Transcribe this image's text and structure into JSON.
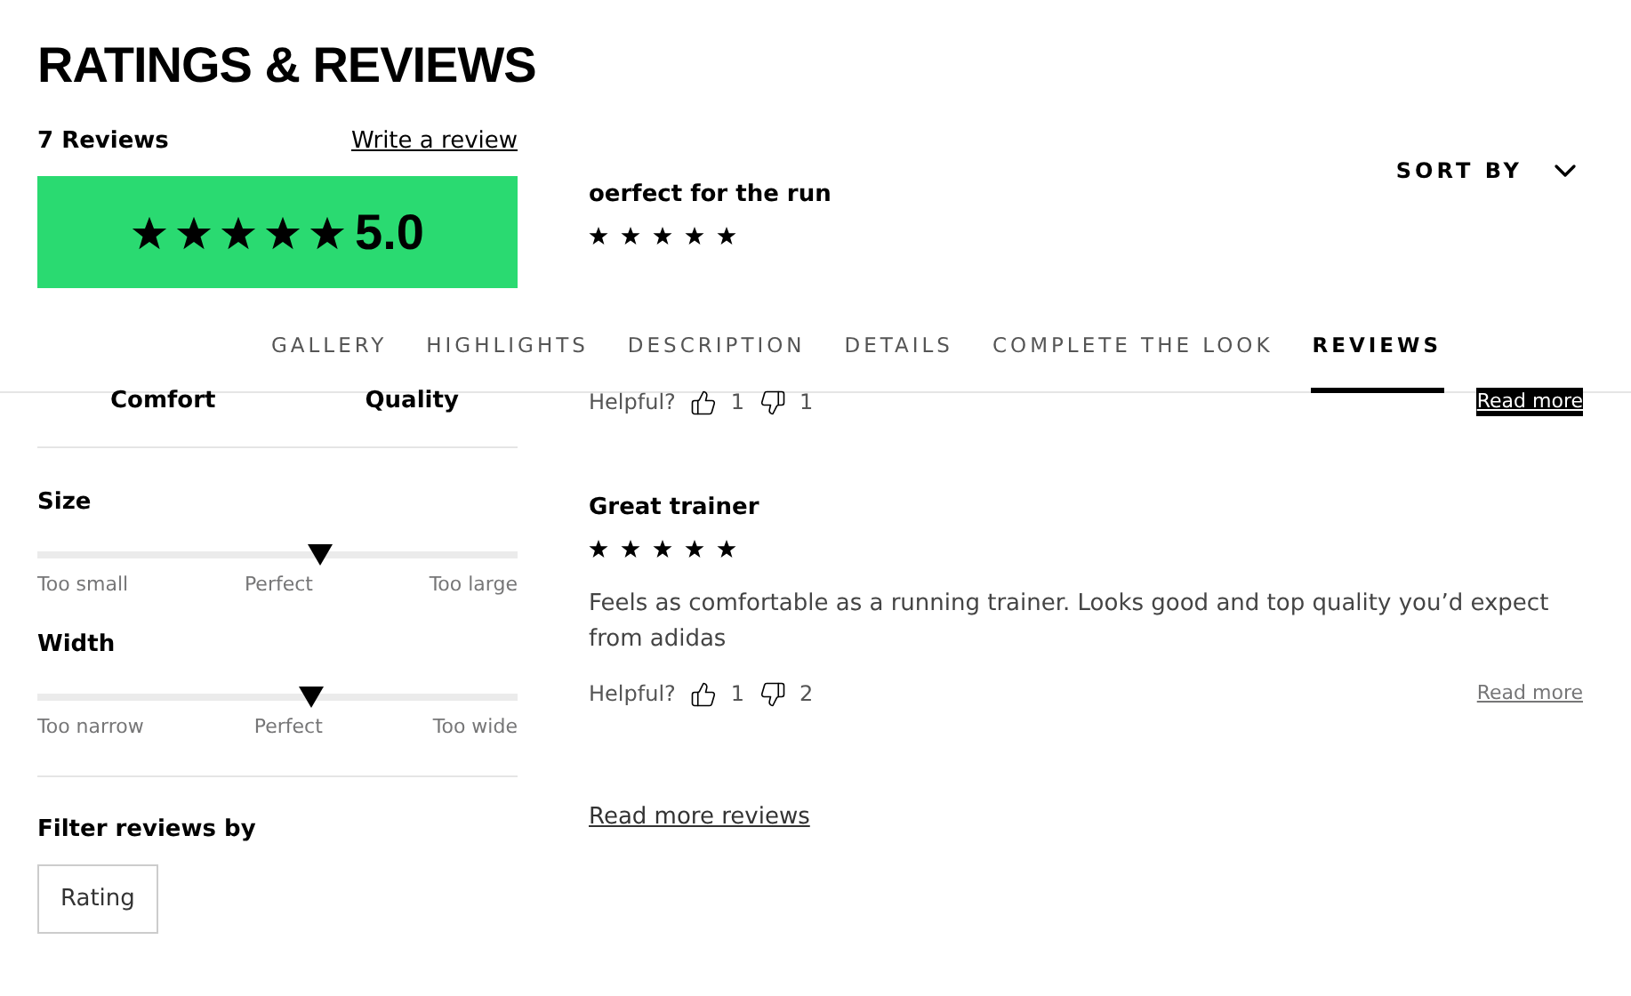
{
  "heading": "RATINGS & REVIEWS",
  "summary": {
    "count": "7 Reviews",
    "write_link": "Write a review",
    "stars": 5,
    "score": "5.0"
  },
  "sort": {
    "label": "SORT BY"
  },
  "nav": {
    "tabs": [
      {
        "label": "GALLERY",
        "selected": false
      },
      {
        "label": "HIGHLIGHTS",
        "selected": false
      },
      {
        "label": "DESCRIPTION",
        "selected": false
      },
      {
        "label": "DETAILS",
        "selected": false
      },
      {
        "label": "COMPLETE THE LOOK",
        "selected": false
      },
      {
        "label": "REVIEWS",
        "selected": true
      }
    ]
  },
  "ratings": {
    "labels": [
      "Comfort",
      "Quality"
    ]
  },
  "fit": [
    {
      "name": "Size",
      "level": 0.59,
      "labels": [
        "Too small",
        "Perfect",
        "Too large"
      ]
    },
    {
      "name": "Width",
      "level": 0.57,
      "labels": [
        "Too narrow",
        "Perfect",
        "Too wide"
      ]
    }
  ],
  "filter": {
    "title": "Filter reviews by",
    "buttons": [
      "Rating"
    ]
  },
  "reviews": [
    {
      "title": "oerfect for the run",
      "stars": 5,
      "helpful_label": "Helpful?",
      "up": "1",
      "down": "1",
      "read_more": "Read more",
      "focused": true
    },
    {
      "title": "Great trainer",
      "stars": 5,
      "body": "Feels as comfortable as a running trainer. Looks good and top quality you’d expect from adidas",
      "helpful_label": "Helpful?",
      "up": "1",
      "down": "2",
      "read_more": "Read more",
      "focused": false
    }
  ],
  "more_link": "Read more reviews"
}
